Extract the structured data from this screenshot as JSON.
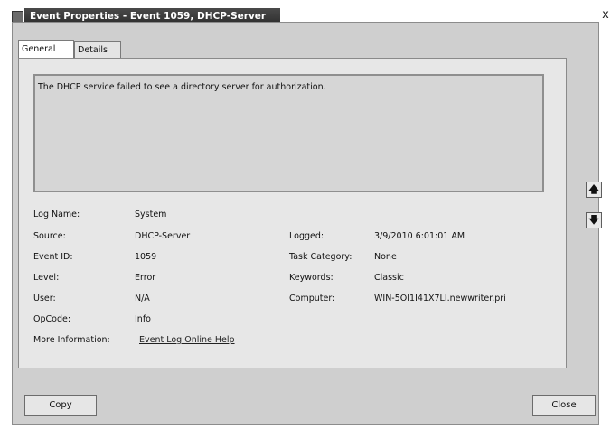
{
  "window": {
    "title": "Event Properties - Event 1059, DHCP-Server",
    "close_glyph": "x"
  },
  "tabs": [
    {
      "label": "General",
      "selected": true
    },
    {
      "label": "Details",
      "selected": false
    }
  ],
  "message": "The DHCP service failed to see a directory server for authorization.",
  "fields": {
    "log_name": {
      "label": "Log Name:",
      "value": "System"
    },
    "source": {
      "label": "Source:",
      "value": "DHCP-Server"
    },
    "event_id": {
      "label": "Event ID:",
      "value": "1059"
    },
    "level": {
      "label": "Level:",
      "value": "Error"
    },
    "user": {
      "label": "User:",
      "value": "N/A"
    },
    "opcode": {
      "label": "OpCode:",
      "value": "Info"
    },
    "more_info": {
      "label": "More Information:",
      "link": "Event Log Online Help"
    },
    "logged": {
      "label": "Logged:",
      "value": "3/9/2010 6:01:01 AM"
    },
    "task_category": {
      "label": "Task Category:",
      "value": "None"
    },
    "keywords": {
      "label": "Keywords:",
      "value": "Classic"
    },
    "computer": {
      "label": "Computer:",
      "value": "WIN-5OI1I41X7LI.newwriter.pri"
    }
  },
  "nav": {
    "up_icon": "arrow-up-icon",
    "down_icon": "arrow-down-icon",
    "up_glyph": "🡅",
    "down_glyph": "🡇"
  },
  "buttons": {
    "copy": "Copy",
    "close": "Close"
  }
}
